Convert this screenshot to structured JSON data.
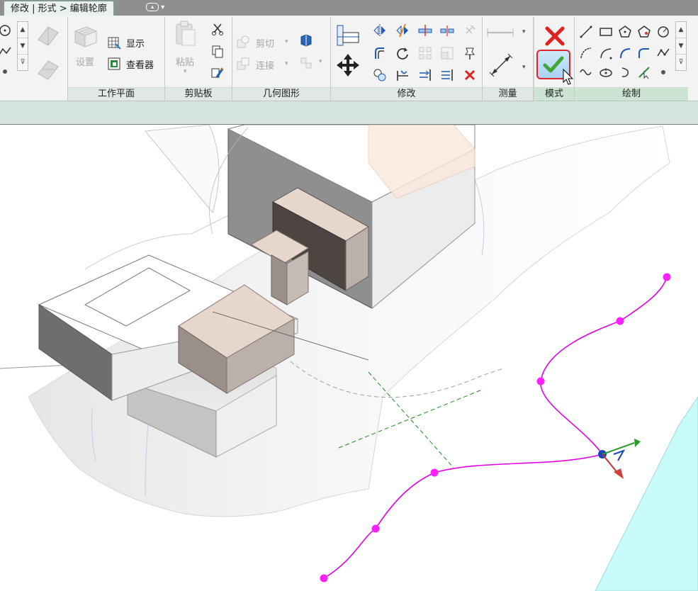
{
  "tab": {
    "title": "修改 | 形式 > 编辑轮廓"
  },
  "panels": {
    "workplane": {
      "title": "工作平面",
      "set_label": "设置",
      "show_label": "显示",
      "viewer_label": "查看器"
    },
    "clipboard": {
      "title": "剪贴板",
      "paste_label": "粘贴"
    },
    "geometry": {
      "title": "几何图形",
      "cut_label": "剪切",
      "join_label": "连接"
    },
    "modify": {
      "title": "修改"
    },
    "measure": {
      "title": "测量"
    },
    "mode": {
      "title": "模式"
    },
    "draw": {
      "title": "绘制"
    }
  },
  "icons": {
    "cancel": "cancel-edit-mode-icon",
    "finish": "finish-edit-mode-icon",
    "cursor": "mouse-pointer-icon"
  },
  "colors": {
    "spline": "#e400e4",
    "spline_point": "#ff20ff",
    "cancel_red": "#e2211c",
    "finish_green": "#3fa73a",
    "water": "#c8fafa",
    "mass_tan": "#e7d6cc",
    "ref_line": "#1e8b1e",
    "accent_ring": "#e0242a"
  }
}
